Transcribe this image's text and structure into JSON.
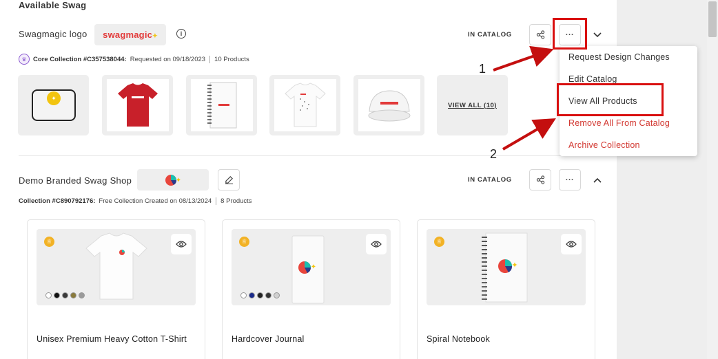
{
  "heading": "Available Swag",
  "collection1": {
    "title": "Swagmagic logo",
    "logo_text": "swagmagic",
    "status": "IN CATALOG",
    "collection_id": "Core Collection #C357538044:",
    "requested": "Requested on 09/18/2023",
    "products_count": "10 Products",
    "view_all": "VIEW ALL (10)"
  },
  "collection2": {
    "title": "Demo Branded Swag Shop",
    "status": "IN CATALOG",
    "collection_id": "Collection #C890792176:",
    "created": "Free Collection Created on 08/13/2024",
    "products_count": "8 Products",
    "cards": [
      {
        "name": "Unisex Premium Heavy Cotton T-Shirt",
        "swatches": [
          "#ffffff",
          "#111111",
          "#3a3a3a",
          "#8a7b3c",
          "#9a9a9a"
        ]
      },
      {
        "name": "Hardcover Journal",
        "swatches": [
          "#ffffff",
          "#1a2a8a",
          "#222222",
          "#333333",
          "#d0d0d0"
        ]
      },
      {
        "name": "Spiral Notebook",
        "swatches": []
      }
    ]
  },
  "menu": {
    "items": [
      {
        "label": "Request Design Changes",
        "style": "dark"
      },
      {
        "label": "Edit Catalog",
        "style": "dark"
      },
      {
        "label": "View All Products",
        "style": "dark"
      },
      {
        "label": "Remove All From Catalog",
        "style": "red"
      },
      {
        "label": "Archive Collection",
        "style": "red"
      }
    ]
  },
  "annotations": {
    "step1": "1",
    "step2": "2"
  },
  "colors": {
    "accent_red": "#d2362f",
    "highlight": "#d90f0f",
    "panel_gray": "#eeeeee"
  }
}
